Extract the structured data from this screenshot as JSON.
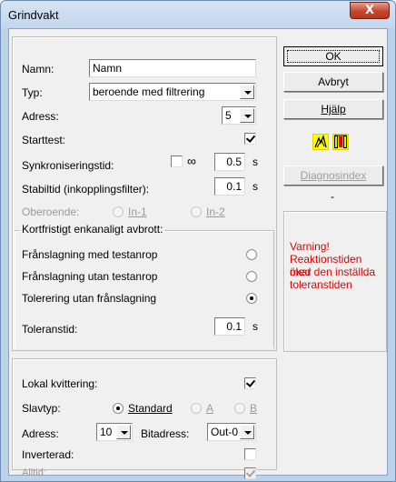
{
  "window": {
    "title": "Grindvakt",
    "close_label": "X"
  },
  "general": {
    "name_label": "Namn:",
    "name_value": "Namn",
    "type_label": "Typ:",
    "type_value": "beroende med filtrering",
    "address_label": "Adress:",
    "address_value": "5",
    "starttest_label": "Starttest:",
    "starttest_checked": true,
    "sync_label": "Synkroniseringstid:",
    "infinity_label": "∞",
    "sync_value": "0.5",
    "sync_unit": "s",
    "stable_label": "Stabiltid (inkopplingsfilter):",
    "stable_value": "0.1",
    "stable_unit": "s",
    "independent_label": "Oberoende:",
    "in1_label": "In-1",
    "in2_label": "In-2"
  },
  "short_break": {
    "title": "Kortfristigt enkanaligt avbrott:",
    "options": [
      {
        "label": "Frånslagning med testanrop",
        "selected": false
      },
      {
        "label": "Frånslagning utan testanrop",
        "selected": false
      },
      {
        "label": "Tolerering utan frånslagning",
        "selected": true
      }
    ],
    "tolerance_label": "Toleranstid:",
    "tolerance_value": "0.1",
    "tolerance_unit": "s"
  },
  "ack": {
    "local_ack_label": "Lokal kvittering:",
    "local_ack_checked": true,
    "slave_type_label": "Slavtyp:",
    "slave_standard": "Standard",
    "slave_a": "A",
    "slave_b": "B",
    "address_label": "Adress:",
    "address_value": "10",
    "bitaddress_label": "Bitadress:",
    "bitaddress_value": "Out-0",
    "inverted_label": "Inverterad:",
    "always_label": "Alltid:"
  },
  "buttons": {
    "ok": "OK",
    "cancel": "Avbryt",
    "help": "Hjälp",
    "diag": "Diagnosindex",
    "dash": "-"
  },
  "warning": {
    "lines": [
      "Varning!",
      "Reaktionstiden ökar",
      "med den inställda",
      "toleranstiden"
    ]
  },
  "colors": {
    "warning": "#e00000",
    "icon_yellow": "#ffff00",
    "icon_red": "#e00000"
  }
}
